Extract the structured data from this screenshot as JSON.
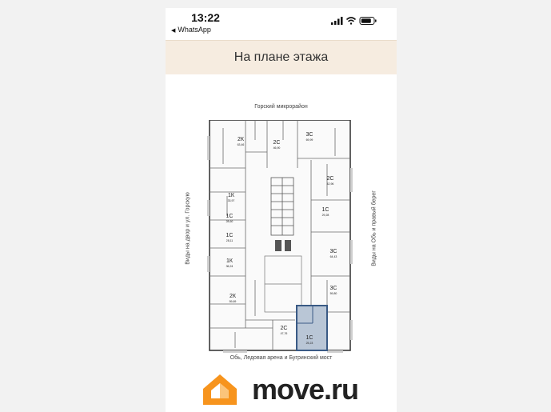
{
  "status_bar": {
    "time": "13:22",
    "back_app": "WhatsApp",
    "icons": [
      "signal-icon",
      "wifi-icon",
      "battery-icon"
    ]
  },
  "header": {
    "title": "На плане этажа"
  },
  "plan": {
    "top_label": "Горский микрорайон",
    "bottom_label": "Обь, Ледовая арена и Бугринский мост",
    "left_label": "Виды на двор и ул. Горскую",
    "right_label": "Виды на Обь и правый берег",
    "rooms": [
      {
        "name": "2К",
        "area": "63,46"
      },
      {
        "name": "2С",
        "area": "46,90"
      },
      {
        "name": "3С",
        "area": "69,99"
      },
      {
        "name": "2С",
        "area": "42,96"
      },
      {
        "name": "1К",
        "area": "33,97"
      },
      {
        "name": "1С",
        "area": "28,60"
      },
      {
        "name": "1С",
        "area": "28,11"
      },
      {
        "name": "1С",
        "area": "29,28"
      },
      {
        "name": "1К",
        "area": "36,24"
      },
      {
        "name": "3С",
        "area": "64,43"
      },
      {
        "name": "3С",
        "area": "59,80"
      },
      {
        "name": "2К",
        "area": "59,69"
      },
      {
        "name": "2С",
        "area": "47,76"
      },
      {
        "name": "1С",
        "area": "25,23"
      }
    ],
    "highlight_color": "#3a5a85",
    "wall_color": "#3b3b3b"
  },
  "logo": {
    "text": "move.ru",
    "brand_color": "#f7941d"
  }
}
